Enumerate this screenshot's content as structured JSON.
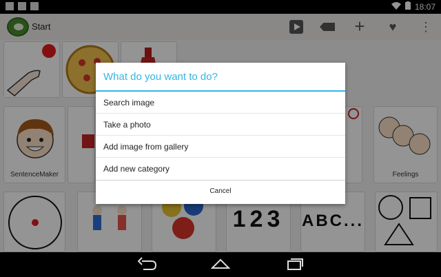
{
  "statusbar": {
    "time": "18:07"
  },
  "actionbar": {
    "title": "Start"
  },
  "tiles": {
    "sentence_maker": "SentenceMaker",
    "feelings": "Feelings",
    "numbers": "123",
    "letters": "ABC..."
  },
  "dialog": {
    "title": "What do you want to do?",
    "options": [
      "Search image",
      "Take a photo",
      "Add image from gallery",
      "Add new category"
    ],
    "cancel": "Cancel"
  },
  "colors": {
    "accent": "#33b5e5",
    "brand": "#4c8a2e"
  }
}
